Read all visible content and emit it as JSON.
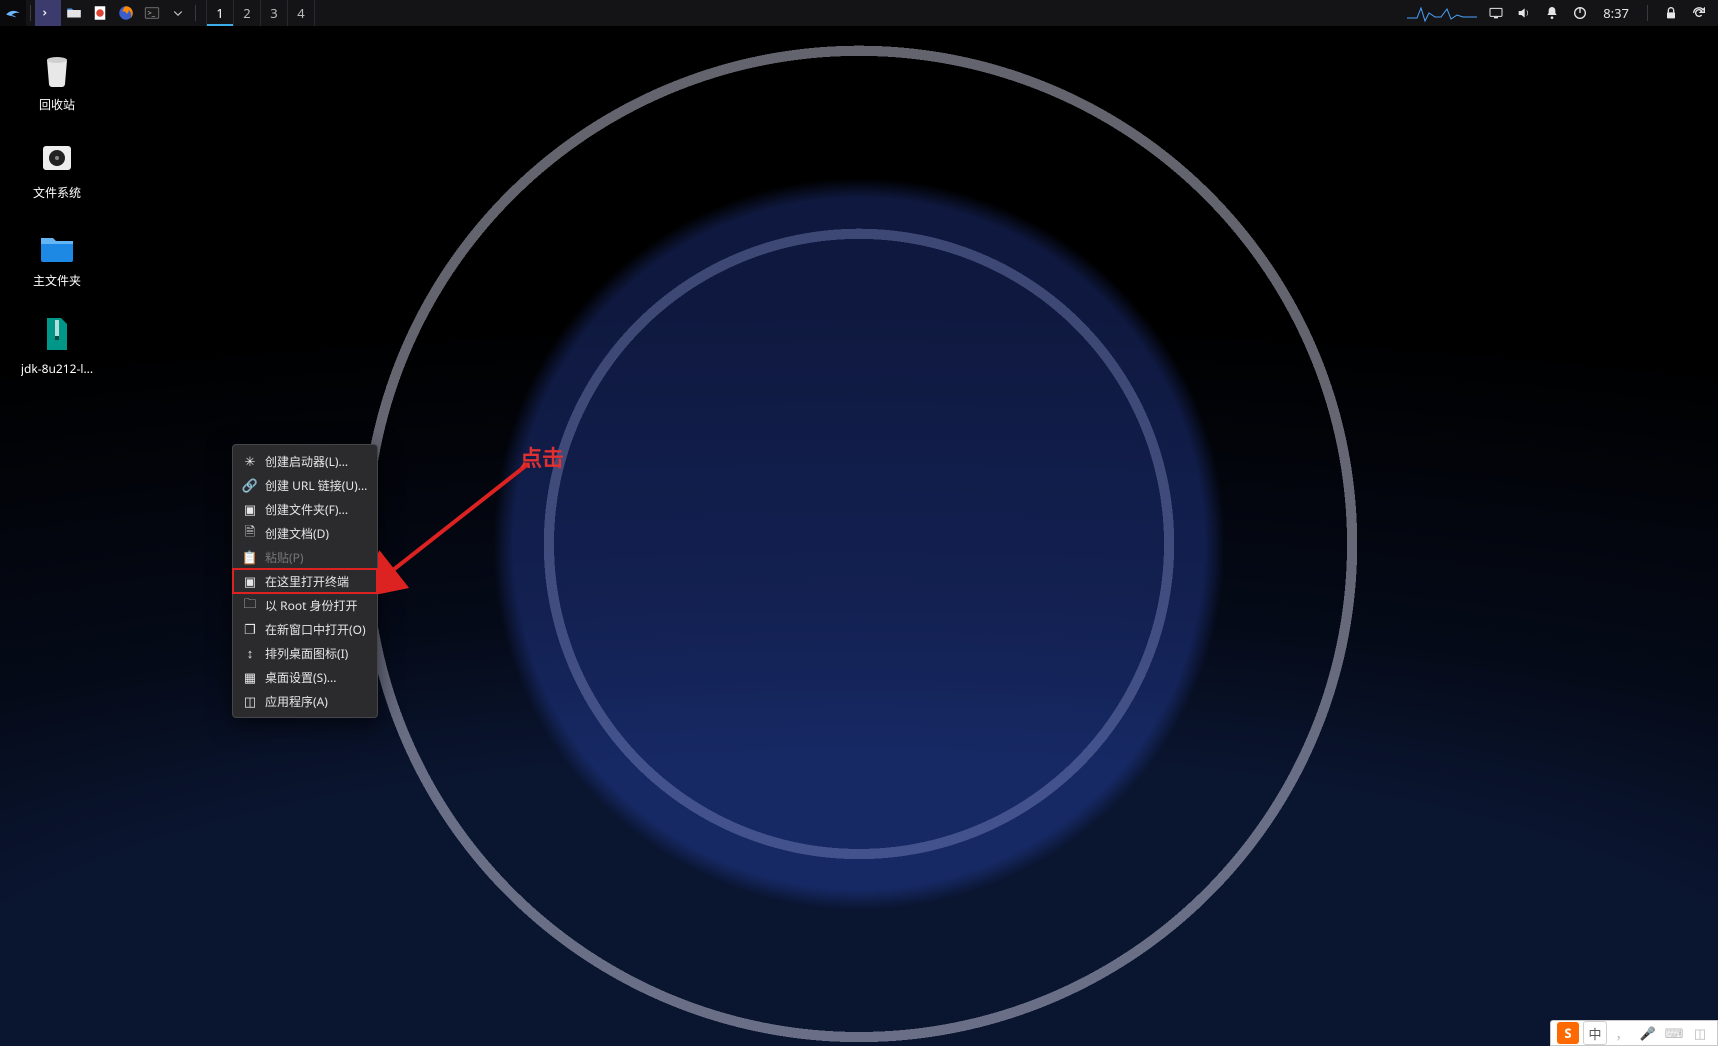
{
  "panel": {
    "workspaces": [
      "1",
      "2",
      "3",
      "4"
    ],
    "active_workspace": 0,
    "clock": "8:37"
  },
  "desktop_icons": [
    {
      "name": "trash",
      "label": "回收站"
    },
    {
      "name": "filesystem",
      "label": "文件系统"
    },
    {
      "name": "home",
      "label": "主文件夹"
    },
    {
      "name": "archive-jdk",
      "label": "jdk-8u212-l..."
    }
  ],
  "context_menu": {
    "items": [
      {
        "key": "create-launcher",
        "label": "创建启动器(L)...",
        "icon": "gear"
      },
      {
        "key": "create-url",
        "label": "创建 URL 链接(U)...",
        "icon": "link"
      },
      {
        "key": "create-folder",
        "label": "创建文件夹(F)...",
        "icon": "folder-plus"
      },
      {
        "key": "create-document",
        "label": "创建文档(D)",
        "icon": "file",
        "submenu": true
      },
      {
        "key": "paste",
        "label": "粘贴(P)",
        "icon": "clipboard",
        "disabled": true
      },
      {
        "key": "open-terminal",
        "label": "在这里打开终端",
        "icon": "terminal",
        "highlighted": true
      },
      {
        "key": "open-as-root",
        "label": "以 Root 身份打开",
        "icon": "folder"
      },
      {
        "key": "open-new-window",
        "label": "在新窗口中打开(O)",
        "icon": "window"
      },
      {
        "key": "arrange-icons",
        "label": "排列桌面图标(I)",
        "icon": "grid"
      },
      {
        "key": "desktop-settings",
        "label": "桌面设置(S)...",
        "icon": "settings"
      },
      {
        "key": "applications",
        "label": "应用程序(A)",
        "icon": "apps",
        "submenu": true
      }
    ]
  },
  "annotation": {
    "text": "点击"
  },
  "ime": {
    "logo": "S",
    "lang": "中"
  }
}
